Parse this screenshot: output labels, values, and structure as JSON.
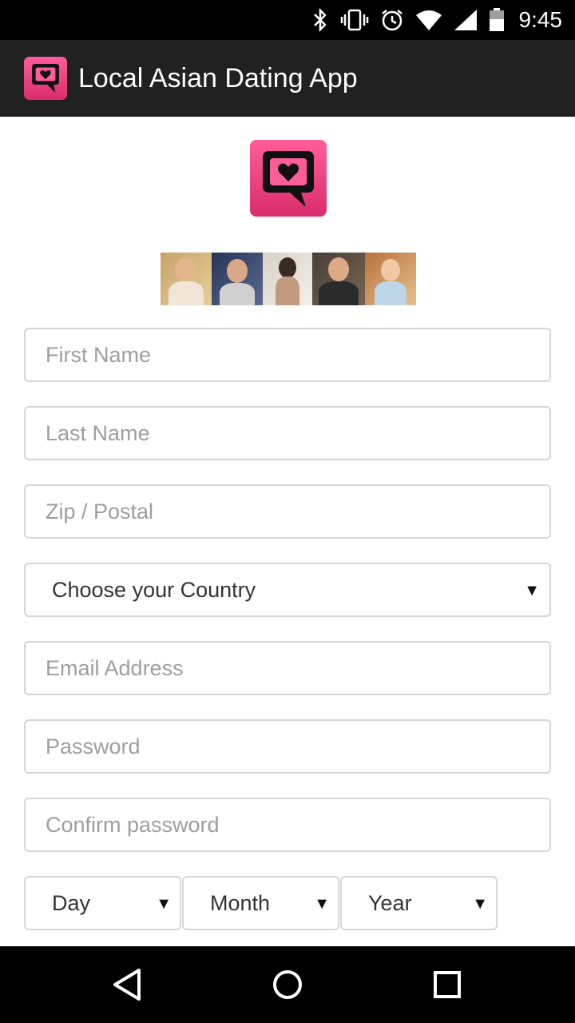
{
  "status_bar": {
    "time": "9:45",
    "icons": [
      "bluetooth-icon",
      "vibrate-icon",
      "alarm-icon",
      "wifi-icon",
      "signal-icon",
      "battery-icon"
    ]
  },
  "toolbar": {
    "title": "Local Asian Dating App",
    "logo_icon": "chat-heart-icon"
  },
  "form": {
    "first_name_placeholder": "First Name",
    "last_name_placeholder": "Last Name",
    "zip_placeholder": "Zip / Postal",
    "country_select": "Choose your Country",
    "email_placeholder": "Email Address",
    "password_placeholder": "Password",
    "confirm_password_placeholder": "Confirm password",
    "day_select": "Day",
    "month_select": "Month",
    "year_select": "Year"
  },
  "colors": {
    "brand_pink": "#e8407f",
    "toolbar_bg": "#212121",
    "field_border": "#d6d6d6",
    "placeholder": "#9e9e9e"
  },
  "nav_bar": {
    "icons": [
      "back-icon",
      "home-icon",
      "recents-icon"
    ]
  }
}
